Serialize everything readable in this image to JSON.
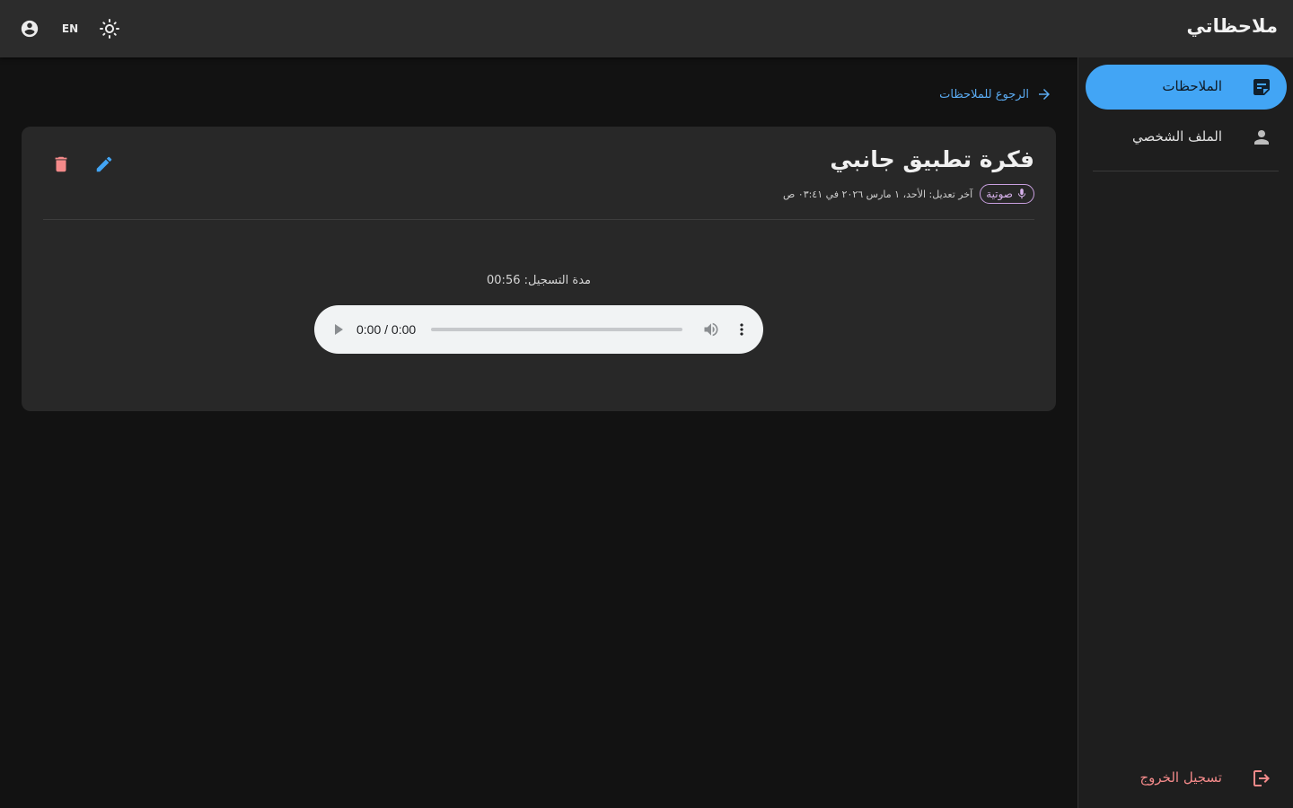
{
  "app": {
    "title": "ملاحظاتي"
  },
  "toolbar": {
    "lang_label": "EN"
  },
  "sidebar": {
    "items": [
      {
        "label": "الملاحظات",
        "icon": "sticky-note-icon",
        "active": true
      },
      {
        "label": "الملف الشخصي",
        "icon": "person-icon",
        "active": false
      }
    ],
    "logout_label": "تسجيل الخروج"
  },
  "note": {
    "back_label": "الرجوع للملاحظات",
    "title": "فكرة تطبيق جانبي",
    "type_chip": "صوتية",
    "modified": "آخر تعديل: الأحد، ١ مارس ٢٠٢٦ في ٠٣:٤١ ص",
    "duration": "مدة التسجيل: 00:56",
    "player_time": "0:00 / 0:00"
  },
  "colors": {
    "accent": "#42a5f5",
    "delete": "#f48a8a",
    "edit": "#42a5f5",
    "chip": "#d7b2ec"
  }
}
